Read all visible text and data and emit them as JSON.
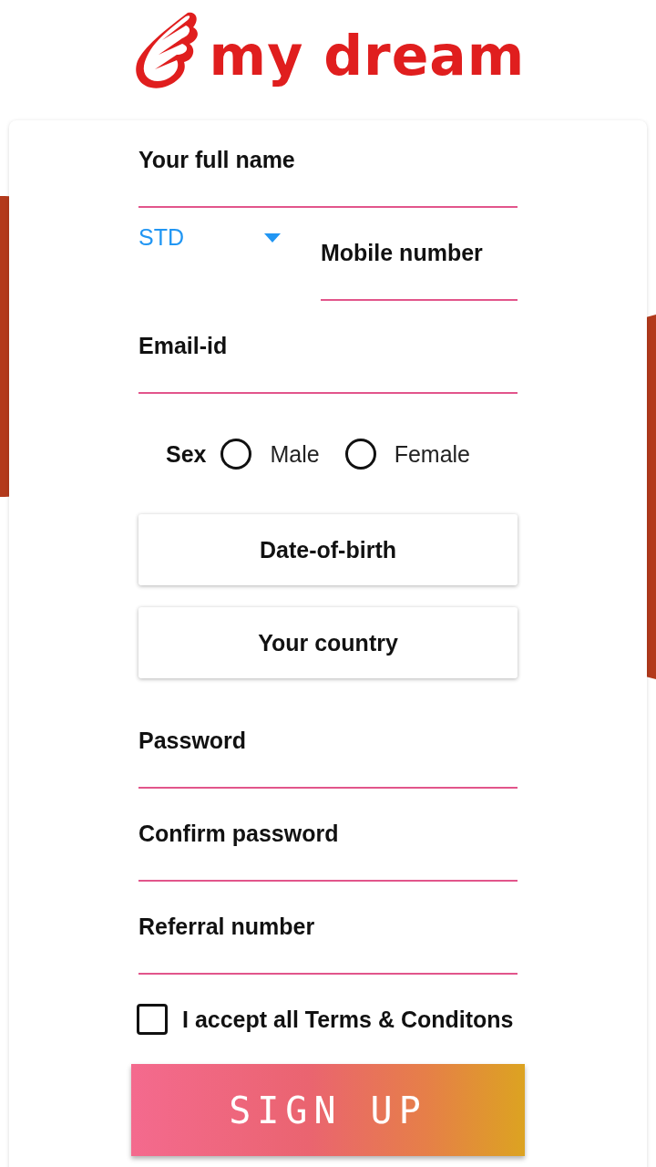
{
  "logo": {
    "text": "my dream"
  },
  "fields": [
    {
      "kind": "text",
      "placeholder": "Your full name"
    },
    {
      "kind": "phone",
      "code": "STD",
      "placeholder": "Mobile number"
    },
    {
      "kind": "text",
      "placeholder": "Email-id"
    },
    {
      "kind": "radio",
      "label": "Sex",
      "options": [
        {
          "label": "Male",
          "selected": false
        },
        {
          "label": "Female",
          "selected": false
        }
      ]
    },
    {
      "kind": "picker",
      "label": "Date-of-birth"
    },
    {
      "kind": "picker",
      "label": "Your country"
    },
    {
      "kind": "password",
      "placeholder": "Password"
    },
    {
      "kind": "password",
      "placeholder": "Confirm password"
    },
    {
      "kind": "text",
      "placeholder": "Referral number"
    }
  ],
  "terms": {
    "label": "I accept all Terms & Conditons",
    "checked": false
  },
  "submit": "SIGN UP"
}
